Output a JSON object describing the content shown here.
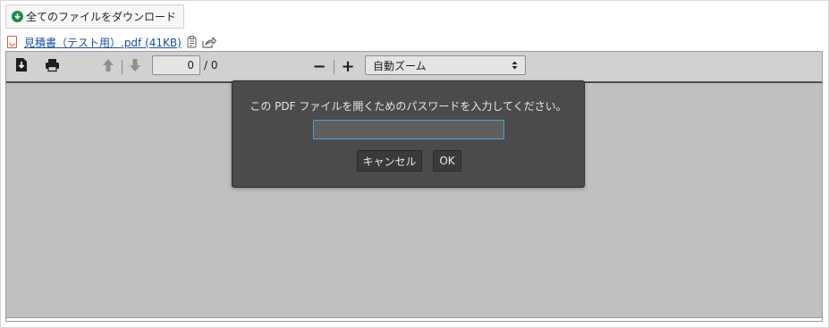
{
  "attachments": {
    "download_all_label": "全てのファイルをダウンロード",
    "file": {
      "name": "見積書（テスト用）.pdf (41KB)"
    }
  },
  "viewer": {
    "toolbar": {
      "page_value": "0",
      "page_count": "/ 0",
      "zoom_selected": "自動ズーム",
      "zoom_out": "−",
      "zoom_in": "+"
    },
    "password_dialog": {
      "message": "この PDF ファイルを開くためのパスワードを入力してください。",
      "password_value": "",
      "cancel_label": "キャンセル",
      "ok_label": "OK"
    }
  },
  "icons": {
    "download_all": "download-circle-icon",
    "pdf_file": "pdf-file-icon",
    "clipboard": "clipboard-icon",
    "share": "share-icon",
    "viewer_download": "download-icon",
    "print": "print-icon",
    "prev_page": "arrow-up-icon",
    "next_page": "arrow-down-icon",
    "zoom_dropdown": "updown-arrows-icon"
  },
  "colors": {
    "link": "#1a4fa0",
    "viewer_background": "#c0c0c0",
    "toolbar_background": "#d1d1d1",
    "dialog_background": "#4b4b4b",
    "input_focus": "#4da3d9",
    "download_badge": "#1f8a4c"
  }
}
